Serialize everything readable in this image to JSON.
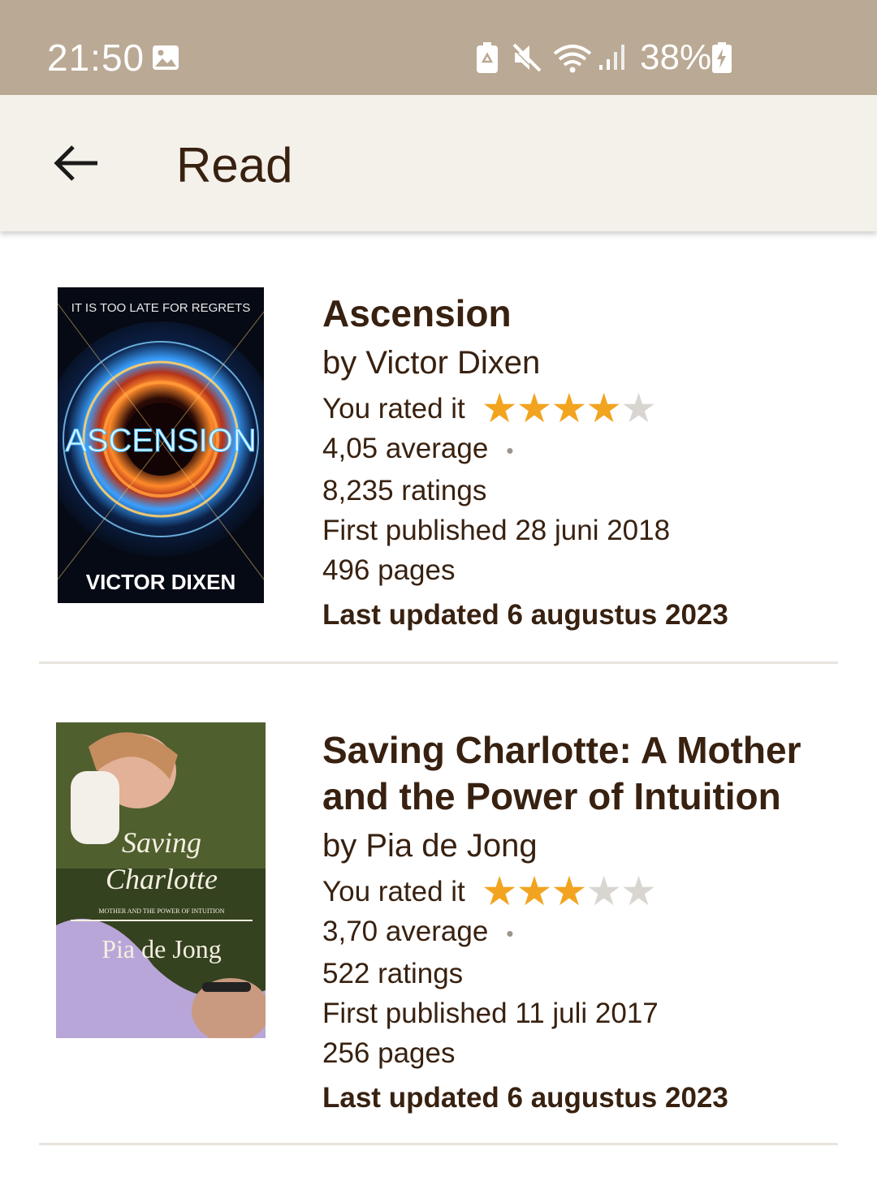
{
  "status_bar": {
    "time": "21:50",
    "battery_percent": "38%",
    "icons": [
      "gallery-icon",
      "battery-saver-icon",
      "mute-icon",
      "wifi-icon",
      "signal-icon",
      "battery-charging-icon"
    ]
  },
  "app_bar": {
    "back_icon": "arrow-left-icon",
    "title": "Read"
  },
  "books": [
    {
      "cover": {
        "tagline": "IT IS TOO LATE FOR REGRETS",
        "title": "ASCENSION",
        "author": "VICTOR DIXEN"
      },
      "title": "Ascension",
      "author": "by Victor Dixen",
      "rated_label": "You rated it",
      "user_rating": 4,
      "max_rating": 5,
      "average": "4,05 average",
      "ratings": "8,235 ratings",
      "first_published": "First published 28 juni 2018",
      "pages": "496 pages",
      "last_updated": "Last updated 6 augustus 2023"
    },
    {
      "cover": {
        "title_line1": "Saving",
        "title_line2": "Charlotte",
        "subtitle": "MOTHER AND THE POWER OF INTUITION",
        "author": "Pia de Jong"
      },
      "title": "Saving Charlotte: A Mother and the Power of Intuition",
      "author": "by Pia de Jong",
      "rated_label": "You rated it",
      "user_rating": 3,
      "max_rating": 5,
      "average": "3,70 average",
      "ratings": "522 ratings",
      "first_published": "First published 11 juli 2017",
      "pages": "256 pages",
      "last_updated": "Last updated 6 augustus 2023"
    }
  ],
  "colors": {
    "status_bar": "#baa994",
    "app_bar": "#f4f1ea",
    "text": "#382110",
    "star_on": "#f2a420",
    "star_off": "#d9d6d1"
  }
}
